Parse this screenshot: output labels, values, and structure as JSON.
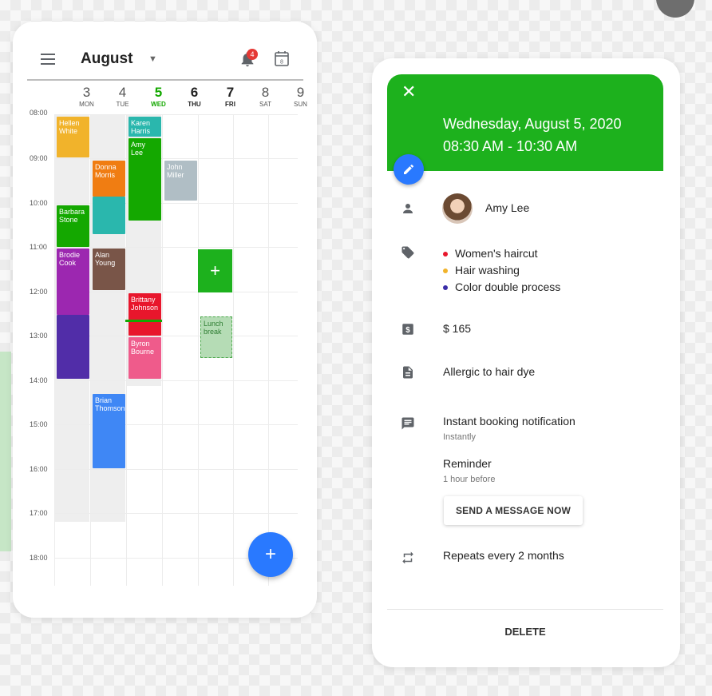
{
  "calendar": {
    "month": "August",
    "notification_count": "4",
    "calendar_icon_day": "8",
    "days": [
      {
        "num": "3",
        "dow": "MON"
      },
      {
        "num": "4",
        "dow": "TUE"
      },
      {
        "num": "5",
        "dow": "WED"
      },
      {
        "num": "6",
        "dow": "THU"
      },
      {
        "num": "7",
        "dow": "FRI"
      },
      {
        "num": "8",
        "dow": "SAT"
      },
      {
        "num": "9",
        "dow": "SUN"
      }
    ],
    "hours": [
      "08:00",
      "09:00",
      "10:00",
      "11:00",
      "12:00",
      "13:00",
      "14:00",
      "15:00",
      "16:00",
      "17:00",
      "18:00"
    ],
    "events": [
      {
        "name": "Hellen White",
        "color": "#f1b32b"
      },
      {
        "name": "Donna Morris",
        "color": "#f07d12"
      },
      {
        "name": "Karen Harris",
        "color": "#2ab7ad"
      },
      {
        "name": "Amy Lee",
        "color": "#14a800"
      },
      {
        "name": "John Miller",
        "color": "#b0bec5"
      },
      {
        "name": "Barbara Stone",
        "color": "#14a800"
      },
      {
        "name": "Brodie Cook",
        "color": "#9c27b0"
      },
      {
        "name": "Alan Young",
        "color": "#795548"
      },
      {
        "name": "Brittany Johnson",
        "color": "#e8162c"
      },
      {
        "name": "Byron Bourne",
        "color": "#ef5b8b"
      },
      {
        "name": "Brian Thomson",
        "color": "#3f87f5"
      },
      {
        "name": "Lunch break",
        "color": "#b5dcb5"
      }
    ],
    "add_label": "+",
    "fab_label": "+"
  },
  "detail": {
    "close_label": "✕",
    "date": "Wednesday, August 5, 2020",
    "time": "08:30 AM - 10:30 AM",
    "client_name": "Amy Lee",
    "services": [
      {
        "label": "Women's haircut",
        "color": "#e8162c"
      },
      {
        "label": "Hair washing",
        "color": "#f1b32b"
      },
      {
        "label": "Color double process",
        "color": "#3a2da8"
      }
    ],
    "price": "$ 165",
    "note": "Allergic to hair dye",
    "notification_title": "Instant booking notification",
    "notification_sub": "Instantly",
    "reminder_title": "Reminder",
    "reminder_sub": "1 hour before",
    "send_button": "SEND A MESSAGE NOW",
    "repeats": "Repeats every 2 months",
    "delete_button": "DELETE"
  },
  "colors": {
    "accent_green": "#1db11d",
    "fab_blue": "#2979ff"
  }
}
